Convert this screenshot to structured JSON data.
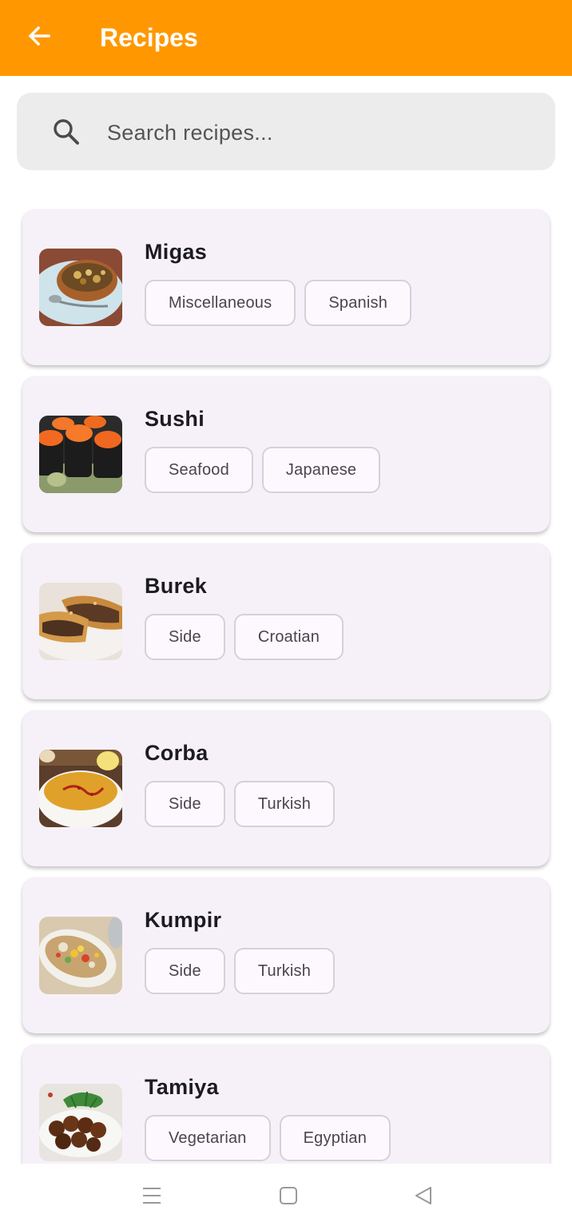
{
  "app_bar": {
    "title": "Recipes",
    "back_icon": "arrow-left-icon",
    "background_color": "#ff9800"
  },
  "search": {
    "placeholder": "Search recipes...",
    "value": "",
    "icon": "search-icon"
  },
  "recipes": [
    {
      "name": "Migas",
      "tags": [
        "Miscellaneous",
        "Spanish"
      ]
    },
    {
      "name": "Sushi",
      "tags": [
        "Seafood",
        "Japanese"
      ]
    },
    {
      "name": "Burek",
      "tags": [
        "Side",
        "Croatian"
      ]
    },
    {
      "name": "Corba",
      "tags": [
        "Side",
        "Turkish"
      ]
    },
    {
      "name": "Kumpir",
      "tags": [
        "Side",
        "Turkish"
      ]
    },
    {
      "name": "Tamiya",
      "tags": [
        "Vegetarian",
        "Egyptian"
      ]
    }
  ],
  "system_nav": {
    "icons": [
      "menu-icon",
      "home-square-icon",
      "back-triangle-icon"
    ]
  }
}
